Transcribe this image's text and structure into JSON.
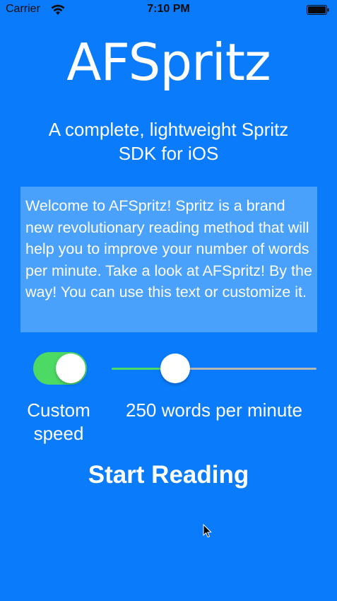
{
  "status_bar": {
    "carrier": "Carrier",
    "time": "7:10 PM",
    "wifi_icon": "wifi-icon",
    "battery_icon": "battery-icon"
  },
  "header": {
    "title": "AFSpritz",
    "subtitle": "A complete, lightweight Spritz SDK for iOS"
  },
  "text_view": {
    "value": "Welcome to AFSpritz! Spritz is a brand new revolutionary reading method that will help you to improve your number of words per minute. Take a look at AFSpritz! By the way! You can use this text or customize it."
  },
  "controls": {
    "custom_speed_toggle": {
      "on": true,
      "label": "Custom speed"
    },
    "speed_slider": {
      "fraction": 0.28,
      "label": "250 words per minute"
    },
    "start_button_label": "Start Reading"
  },
  "colors": {
    "background": "#0a7cfb",
    "text_box": "#4aa1fc",
    "toggle_on": "#4cd964",
    "slider_track": "#b6b6b6"
  }
}
